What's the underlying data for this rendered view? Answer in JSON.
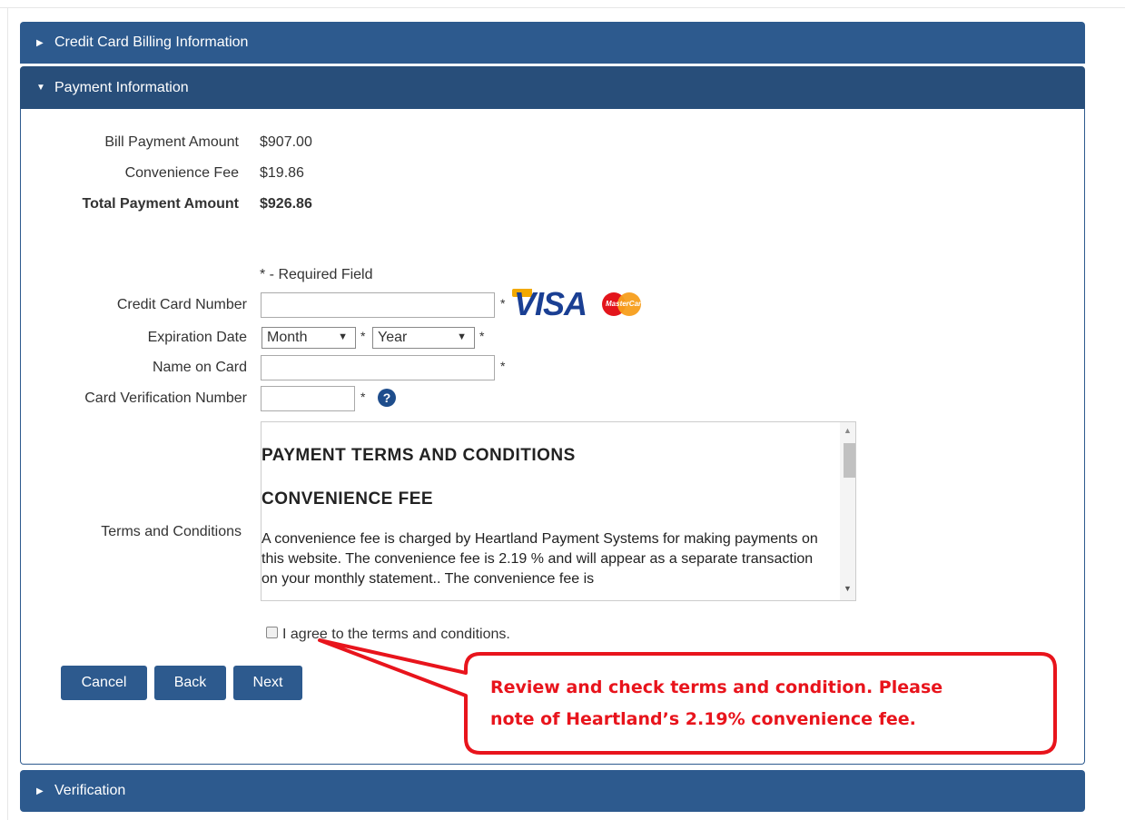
{
  "sections": {
    "billing": "Credit Card Billing Information",
    "payment": "Payment Information",
    "verification": "Verification"
  },
  "summary": {
    "bill_label": "Bill Payment Amount",
    "bill_value": "$907.00",
    "fee_label": "Convenience Fee",
    "fee_value": "$19.86",
    "total_label": "Total Payment Amount",
    "total_value": "$926.86"
  },
  "form": {
    "required_note": "* - Required Field",
    "card_number_label": "Credit Card Number",
    "card_number_value": "",
    "expiration_label": "Expiration Date",
    "month_value": "Month",
    "year_value": "Year",
    "name_label": "Name on Card",
    "name_value": "",
    "cvv_label": "Card Verification Number",
    "cvv_value": "",
    "required_mark": "*",
    "help_glyph": "?",
    "terms_label": "Terms and Conditions"
  },
  "brands": {
    "visa": "VISA",
    "mastercard": "MasterCard"
  },
  "terms": {
    "heading1": "PAYMENT TERMS AND CONDITIONS",
    "heading2": "CONVENIENCE FEE",
    "body": "A convenience fee is charged by Heartland Payment Systems for making payments on this website. The convenience fee is 2.19 % and will appear as a separate transaction on your monthly statement.. The convenience fee is"
  },
  "agree_label": "I agree to the terms and conditions.",
  "buttons": {
    "cancel": "Cancel",
    "back": "Back",
    "next": "Next"
  },
  "callout": {
    "line1": "Review and check terms and condition. Please",
    "line2": "note of Heartland’s 2.19% convenience fee.",
    "color": "#e8141c"
  },
  "colors": {
    "header": "#2d5a8e",
    "header_active": "#284e7a"
  }
}
